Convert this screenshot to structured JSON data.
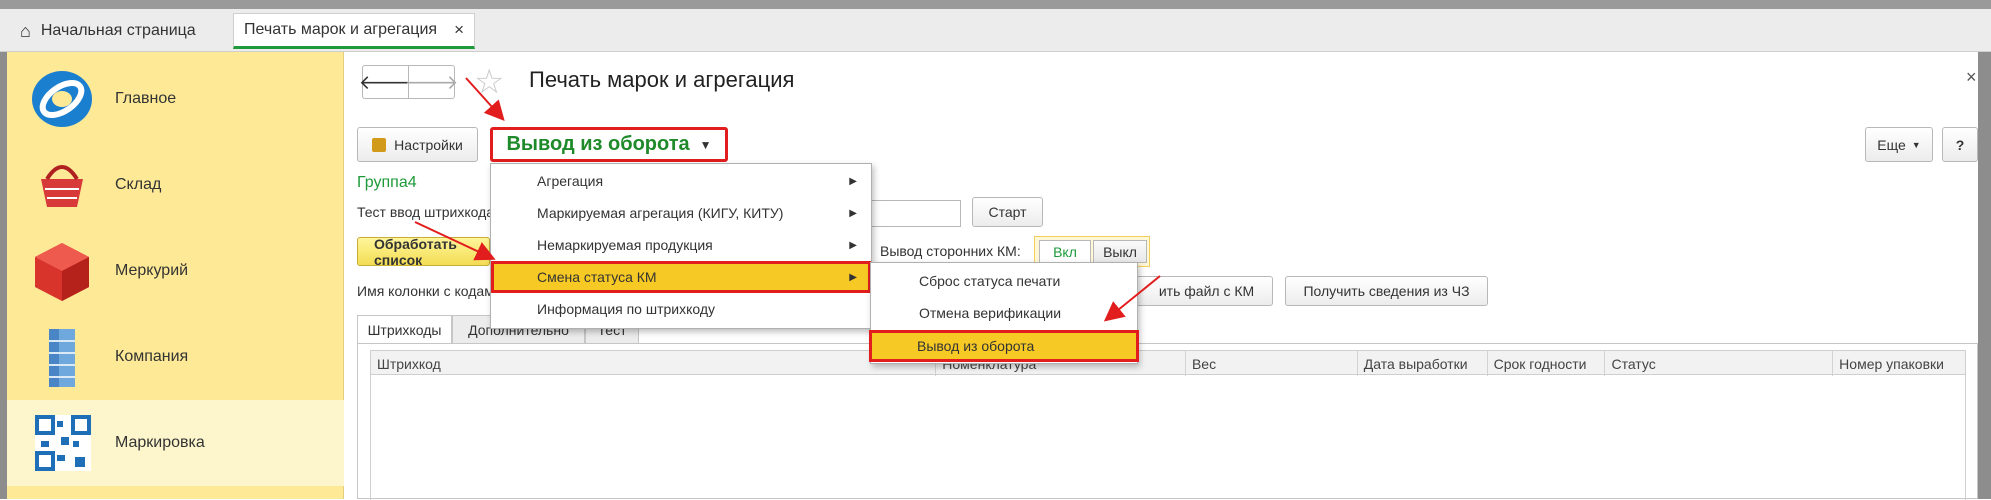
{
  "tabs": {
    "home_label": "Начальная страница",
    "active_label": "Печать марок и агрегация",
    "close_glyph": "×"
  },
  "sidebar": {
    "items": [
      {
        "label": "Главное",
        "icon": "main-globe-icon"
      },
      {
        "label": "Склад",
        "icon": "basket-icon"
      },
      {
        "label": "Меркурий",
        "icon": "cube-icon"
      },
      {
        "label": "Компания",
        "icon": "building-icon"
      },
      {
        "label": "Маркировка",
        "icon": "qr-code-icon"
      }
    ]
  },
  "header": {
    "title": "Печать марок и агрегация",
    "back_glyph": "🡐",
    "fwd_glyph": "🡒",
    "star_glyph": "☆",
    "close_glyph": "×"
  },
  "toolbar": {
    "settings_label": "Настройки",
    "vyvod_label": "Вывод из оборота",
    "eshe_label": "Еще",
    "help_label": "?"
  },
  "form": {
    "group": "Группа4",
    "test_label": "Тест ввод штрихкода",
    "start_label": "Старт",
    "obrab_label": "Обработать список",
    "third_party_label": "Вывод сторонних КМ:",
    "toggle_on": "Вкл",
    "toggle_off": "Выкл",
    "column_name_label": "Имя колонки с кодами",
    "file_label": "ить файл с КМ",
    "info_label": "Получить сведения из ЧЗ"
  },
  "page_tabs": [
    "Штрихкоды",
    "Дополнительно",
    "Тест"
  ],
  "table": {
    "columns": [
      "Штрихкод",
      "Номенклатура",
      "Вес",
      "Дата выработки",
      "Срок годности",
      "Статус",
      "Номер упаковки"
    ]
  },
  "menu": {
    "items": [
      {
        "label": "Агрегация",
        "has_sub": true
      },
      {
        "label": "Маркируемая агрегация (КИГУ, КИТУ)",
        "has_sub": true
      },
      {
        "label": "Немаркируемая продукция",
        "has_sub": true
      },
      {
        "label": "Смена статуса КМ",
        "has_sub": true,
        "highlighted": true
      },
      {
        "label": "Информация по штрихкоду",
        "has_sub": false
      }
    ],
    "submenu": [
      {
        "label": "Сброс статуса печати"
      },
      {
        "label": "Отмена верификации"
      },
      {
        "label": "Вывод из оборота",
        "highlighted": true
      }
    ]
  },
  "colors": {
    "accent_green": "#1f9a3a",
    "highlight": "#f7c924",
    "annotation_red": "#e11d1d",
    "sidebar_bg": "#fde996"
  }
}
